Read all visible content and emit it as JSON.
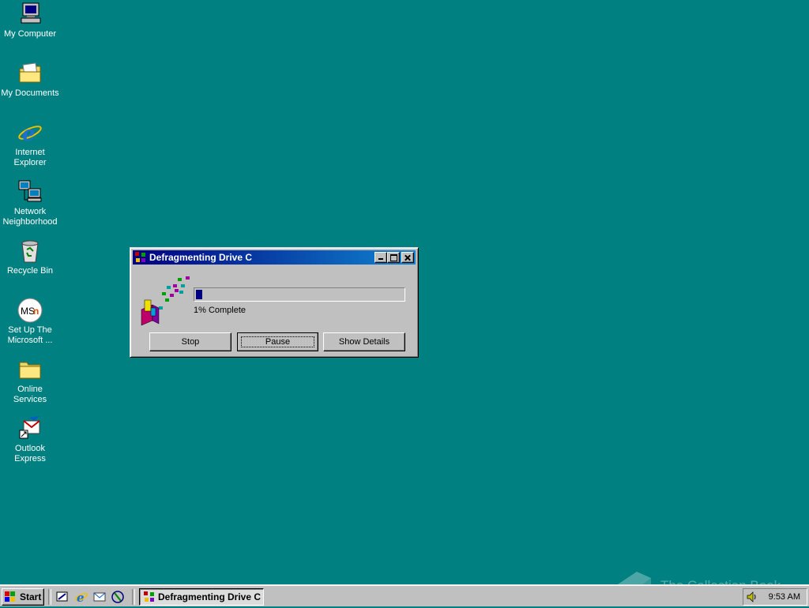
{
  "desktop": {
    "background_color": "#008080",
    "icons": [
      {
        "label": "My Computer",
        "icon": "my-computer-icon"
      },
      {
        "label": "My Documents",
        "icon": "my-documents-icon"
      },
      {
        "label": "Internet Explorer",
        "icon": "internet-explorer-icon"
      },
      {
        "label": "Network Neighborhood",
        "icon": "network-neighborhood-icon"
      },
      {
        "label": "Recycle Bin",
        "icon": "recycle-bin-icon"
      },
      {
        "label": "Set Up The Microsoft ...",
        "icon": "msn-icon"
      },
      {
        "label": "Online Services",
        "icon": "folder-icon"
      },
      {
        "label": "Outlook Express",
        "icon": "outlook-express-icon"
      }
    ]
  },
  "dialog": {
    "title": "Defragmenting Drive C",
    "progress_percent": 1,
    "progress_text": "1% Complete",
    "buttons": {
      "stop": "Stop",
      "pause": "Pause",
      "show_details": "Show Details"
    }
  },
  "taskbar": {
    "start_label": "Start",
    "quick_launch": [
      "show-desktop-icon",
      "internet-explorer-icon",
      "outlook-express-icon",
      "channels-icon"
    ],
    "task_label": "Defragmenting Drive C",
    "clock": "9:53 AM"
  },
  "watermark": {
    "text": "The Collection Book"
  }
}
